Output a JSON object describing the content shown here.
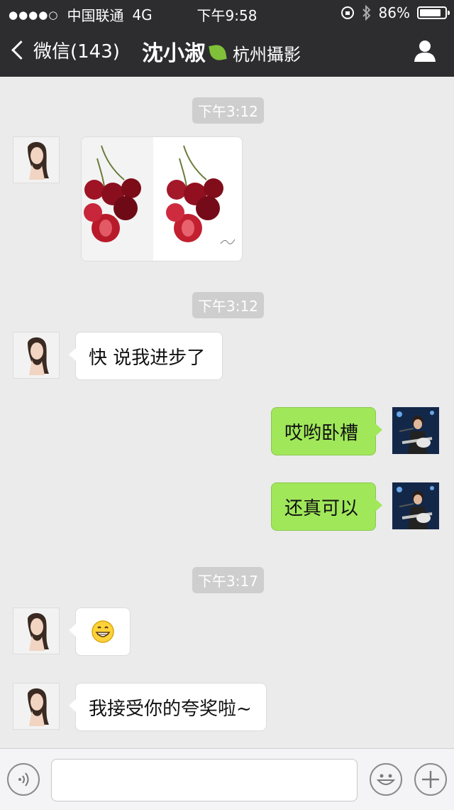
{
  "status": {
    "signal": "●●●●○",
    "carrier": "中国联通",
    "network": "4G",
    "time": "下午9:58",
    "battery": "86%",
    "battery_level": 0.86
  },
  "nav": {
    "back_label": "微信(143)",
    "contact_name": "沈小淑",
    "contact_sub": "杭州攝影",
    "profile_icon": "person-icon"
  },
  "chat": {
    "timestamps": [
      "下午3:12",
      "下午3:12",
      "下午3:17"
    ],
    "messages": [
      {
        "from": "contact",
        "type": "image",
        "desc": "cherries"
      },
      {
        "from": "contact",
        "type": "text",
        "text": "快 说我进步了"
      },
      {
        "from": "me",
        "type": "text",
        "text": "哎哟卧槽"
      },
      {
        "from": "me",
        "type": "text",
        "text": "还真可以"
      },
      {
        "from": "contact",
        "type": "emoji",
        "icon": "grin-emoji-icon"
      },
      {
        "from": "contact",
        "type": "text",
        "text": "我接受你的夸奖啦~"
      }
    ]
  },
  "input": {
    "value": "",
    "placeholder": ""
  },
  "colors": {
    "topbar": "#2d2d2f",
    "chat_bg": "#ebebeb",
    "out_bubble": "#a0e75a",
    "in_bubble": "#ffffff"
  }
}
